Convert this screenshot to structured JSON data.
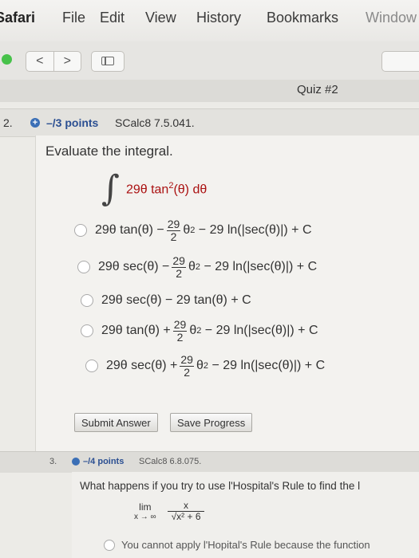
{
  "menubar": {
    "app": "Safari",
    "items": [
      "File",
      "Edit",
      "View",
      "History",
      "Bookmarks",
      "Window"
    ]
  },
  "toolbar": {
    "back": "<",
    "forward": ">"
  },
  "tab": {
    "title": "Quiz #2"
  },
  "question": {
    "number": "2.",
    "points": "–/3 points",
    "source": "SCalc8 7.5.041.",
    "prompt": "Evaluate the integral.",
    "integral_lead": "29θ tan",
    "integral_exp": "2",
    "integral_tail": "(θ) dθ",
    "options": [
      {
        "lead": "29θ tan(θ) −",
        "num": "29",
        "den": "2",
        "mid": "θ",
        "exp": "2",
        "tail": "− 29 ln(|sec(θ)|) + C"
      },
      {
        "lead": "29θ sec(θ) −",
        "num": "29",
        "den": "2",
        "mid": "θ",
        "exp": "2",
        "tail": "− 29 ln(|sec(θ)|) + C"
      },
      {
        "lead": "29θ sec(θ) − 29 tan(θ) + C"
      },
      {
        "lead": "29θ tan(θ) +",
        "num": "29",
        "den": "2",
        "mid": "θ",
        "exp": "2",
        "tail": "− 29 ln(|sec(θ)|) + C"
      },
      {
        "lead": "29θ sec(θ) +",
        "num": "29",
        "den": "2",
        "mid": "θ",
        "exp": "2",
        "tail": "− 29 ln(|sec(θ)|) + C"
      }
    ],
    "submit_label": "Submit Answer",
    "save_label": "Save Progress"
  },
  "next_question": {
    "number": "3.",
    "points": "–/4 points",
    "source": "SCalc8 6.8.075.",
    "prompt": "What happens if you try to use l'Hospital's Rule to find the l",
    "lim_label": "lim",
    "lim_sub": "x → ∞",
    "numerator": "x",
    "denominator": "√x² + 6",
    "option": "You cannot apply l'Hopital's Rule because the function"
  },
  "colors": {
    "accent": "#3b6fb6",
    "integrand": "#aa1111",
    "traffic_green": "#47c24a"
  }
}
